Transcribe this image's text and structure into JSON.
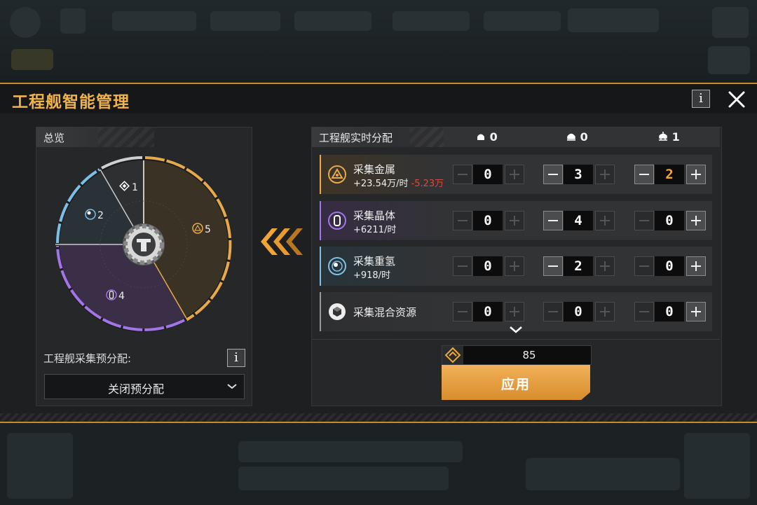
{
  "title": "工程舰智能管理",
  "overview": {
    "header": "总览",
    "segments": [
      {
        "name": "diamond",
        "count": "1"
      },
      {
        "name": "hydrogen",
        "count": "2"
      },
      {
        "name": "metal",
        "count": "5"
      },
      {
        "name": "crystal",
        "count": "4"
      }
    ]
  },
  "preset": {
    "label": "工程舰采集预分配:",
    "select_value": "关闭预分配"
  },
  "realtime": {
    "header": "工程舰实时分配",
    "columns": [
      "0",
      "0",
      "1"
    ],
    "rows": [
      {
        "name": "采集金属",
        "rate": "+23.54万/时",
        "rate_neg": "-5.23万",
        "values": [
          "0",
          "3",
          "2"
        ]
      },
      {
        "name": "采集晶体",
        "rate": "+6211/时",
        "values": [
          "0",
          "4",
          "0"
        ]
      },
      {
        "name": "采集重氢",
        "rate": "+918/时",
        "values": [
          "0",
          "2",
          "0"
        ]
      },
      {
        "name": "采集混合资源",
        "rate": "",
        "values": [
          "0",
          "0",
          "0"
        ]
      }
    ]
  },
  "cost": {
    "value": "85"
  },
  "apply_label": "应用",
  "colors": {
    "accent": "#f0b24a",
    "metal": "#e8a94a",
    "crystal": "#a276e8",
    "hydrogen": "#7dc0e6",
    "negative": "#e0483b"
  }
}
